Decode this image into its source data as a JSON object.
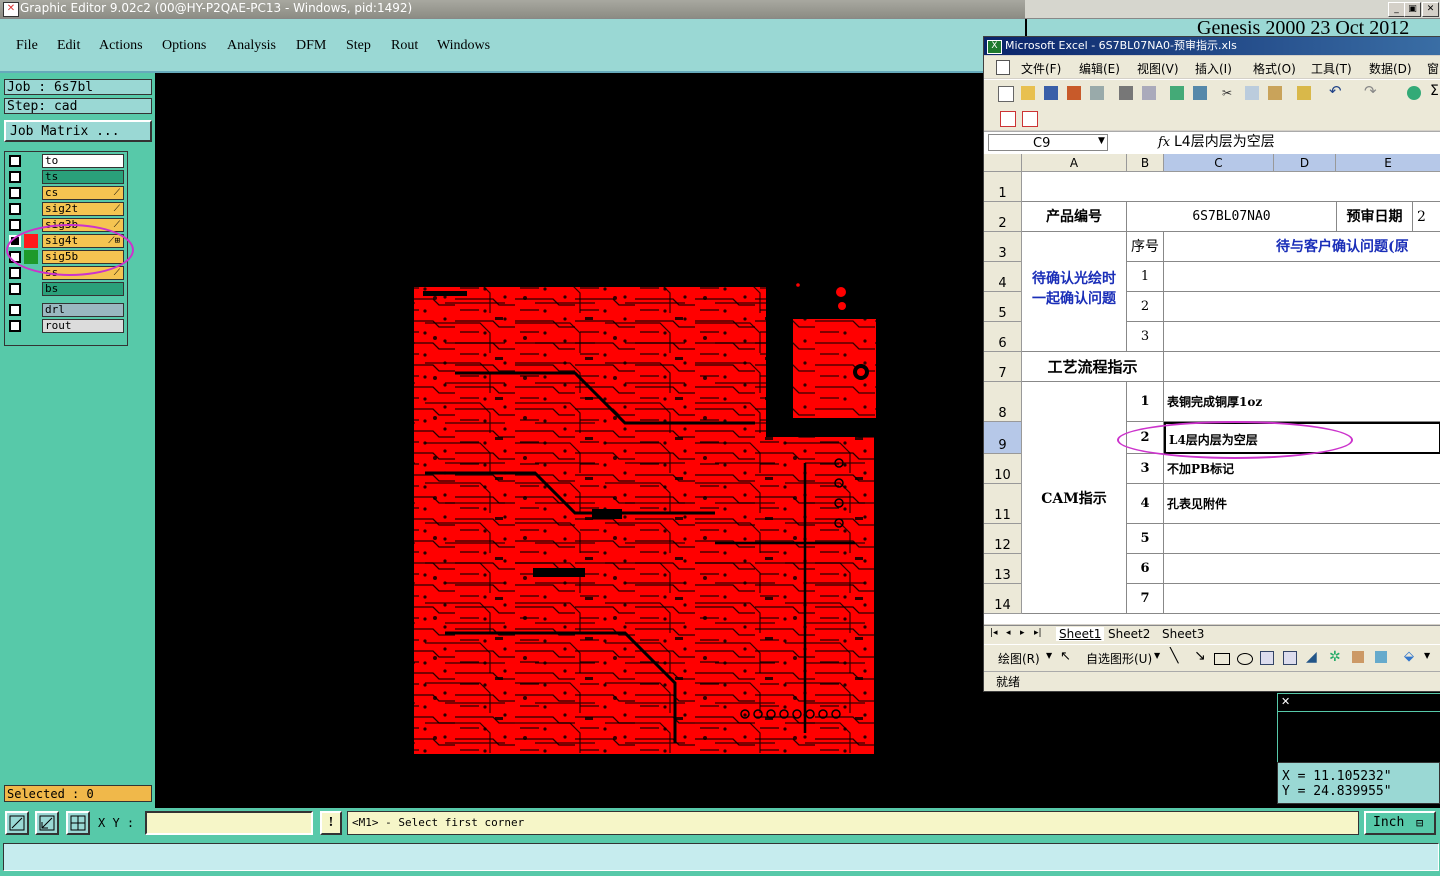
{
  "window": {
    "title": "Graphic Editor 9.02c2 (00@HY-P2QAE-PC13 - Windows, pid:1492)",
    "genesis_header": "Genesis 2000 23 Oct 2012"
  },
  "menu": [
    "File",
    "Edit",
    "Actions",
    "Options",
    "Analysis",
    "DFM",
    "Step",
    "Rout",
    "Windows"
  ],
  "job": {
    "job_line": "Job : 6s7bl",
    "step_line": "Step: cad",
    "matrix_button": "Job Matrix ..."
  },
  "layers": [
    {
      "name": "to",
      "bg": "#ffffff",
      "ind": ""
    },
    {
      "name": "ts",
      "bg": "#2aa07a",
      "ind": ""
    },
    {
      "name": "cs",
      "bg": "#f5c451",
      "ind": "⟋"
    },
    {
      "name": "sig2t",
      "bg": "#f5c451",
      "ind": "⟋"
    },
    {
      "name": "sig3b",
      "bg": "#f5c451",
      "ind": "⟋"
    },
    {
      "name": "sig4t",
      "bg": "#f5c451",
      "ind": "⟋⊞"
    },
    {
      "name": "sig5b",
      "bg": "#f5c451",
      "ind": ""
    },
    {
      "name": "ss",
      "bg": "#f5c451",
      "ind": "⟋"
    },
    {
      "name": "bs",
      "bg": "#2aa07a",
      "ind": ""
    },
    {
      "name": "drl",
      "bg": "#9ab8c0",
      "ind": ""
    },
    {
      "name": "rout",
      "bg": "#dcdcdc",
      "ind": ""
    }
  ],
  "selected": "Selected : 0",
  "bottom": {
    "xy_label": "X Y :",
    "xy_value": "",
    "bang": "!",
    "message": "<M1> - Select first corner",
    "unit": "Inch"
  },
  "coords": {
    "x": "X = 11.105232\"",
    "y": "Y = 24.839955\""
  },
  "excel": {
    "title": "Microsoft Excel - 6S7BL07NA0-预审指示.xls",
    "menus": [
      "文件(F)",
      "编辑(E)",
      "视图(V)",
      "插入(I)",
      "格式(O)",
      "工具(T)",
      "数据(D)",
      "窗"
    ],
    "name_box": "C9",
    "fx": "fx",
    "formula": "L4层内层为空层",
    "columns": [
      "A",
      "B",
      "C",
      "D",
      "E"
    ],
    "rows": [
      "1",
      "2",
      "3",
      "4",
      "5",
      "6",
      "7",
      "8",
      "9",
      "10",
      "11",
      "12",
      "13",
      "14"
    ],
    "cells": {
      "product_no_label": "产品编号",
      "product_no": "6S7BL07NA0",
      "review_date_label": "预审日期",
      "review_date_partial": "2",
      "seq_label": "序号",
      "pending_header": "待与客户确认问题(原",
      "pending_label_1": "待确认光绘时",
      "pending_label_2": "一起确认问题",
      "seq_1": "1",
      "seq_2": "2",
      "seq_3": "3",
      "process_label": "工艺流程指示",
      "cam_label": "CAM指示",
      "cam_seq": [
        "1",
        "2",
        "3",
        "4",
        "5",
        "6",
        "7"
      ],
      "cam_items": [
        "表铜完成铜厚1oz",
        "L4层内层为空层",
        "不加PB标记",
        "孔表见附件",
        "",
        "",
        ""
      ]
    },
    "sheets": [
      "Sheet1",
      "Sheet2",
      "Sheet3"
    ],
    "draw_label": "绘图(R)",
    "autoshape_label": "自选图形(U)",
    "status": "就绪"
  },
  "colors": {
    "copper": "#ff0000",
    "panel": "#57c9a9",
    "menu_bg": "#9ad8d4",
    "highlight_ellipse": "#cc33cc"
  }
}
